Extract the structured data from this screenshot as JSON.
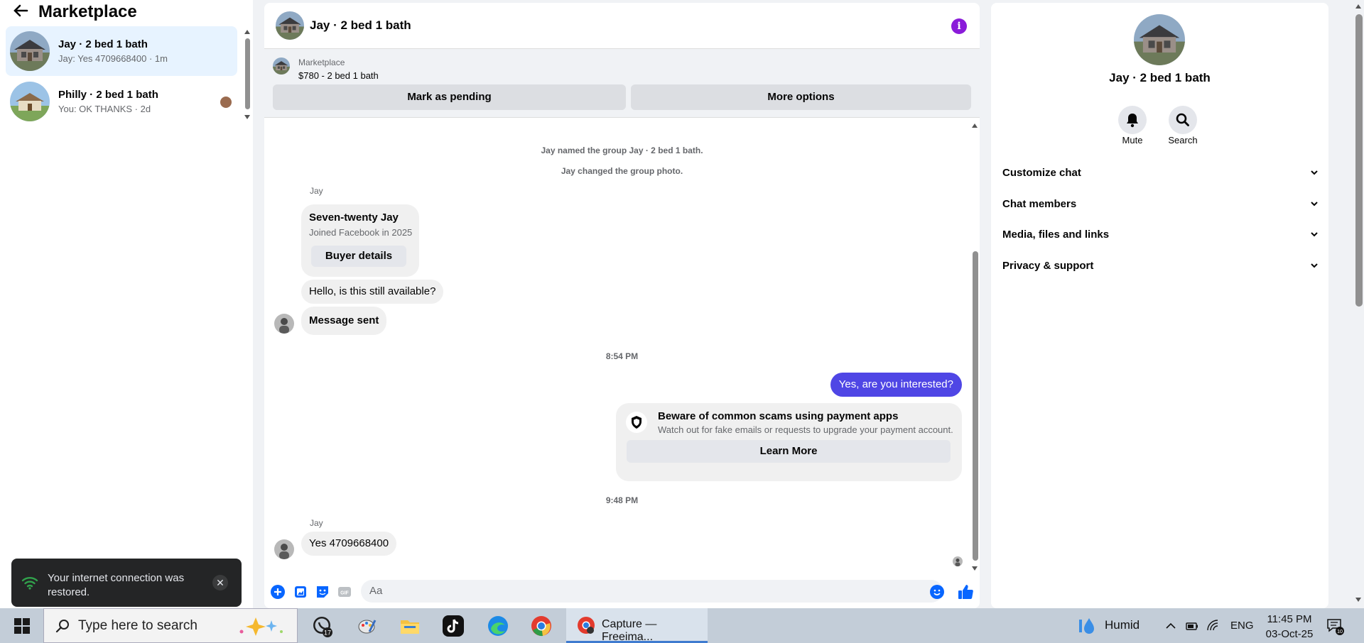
{
  "sidebar": {
    "title": "Marketplace",
    "conversations": [
      {
        "name": "Jay · 2 bed 1 bath",
        "preview": "Jay: Yes 4709668400 · 1m"
      },
      {
        "name": "Philly · 2 bed 1 bath",
        "preview": "You: OK THANKS · 2d"
      }
    ]
  },
  "chat": {
    "title": "Jay · 2 bed 1 bath",
    "listing": {
      "source": "Marketplace",
      "price_title": "$780 - 2 bed 1 bath"
    },
    "buttons": {
      "mark_pending": "Mark as pending",
      "more_options": "More options"
    },
    "system_messages": [
      "Jay named the group Jay · 2 bed 1 bath.",
      "Jay changed the group photo."
    ],
    "sender_name": "Jay",
    "profile_card": {
      "name": "Seven-twenty Jay",
      "joined": "Joined Facebook in 2025",
      "button": "Buyer details"
    },
    "messages": {
      "m1": "Hello, is this still available?",
      "m2": "Message sent",
      "time1": "8:54 PM",
      "out1": "Yes, are you interested?",
      "time2": "9:48 PM",
      "m3": "Yes 4709668400"
    },
    "warning": {
      "title": "Beware of common scams using payment apps",
      "desc": "Watch out for fake emails or requests to upgrade your payment account.",
      "button": "Learn More"
    },
    "composer_placeholder": "Aa"
  },
  "details": {
    "name": "Jay · 2 bed 1 bath",
    "actions": {
      "mute": "Mute",
      "search": "Search"
    },
    "sections": [
      "Customize chat",
      "Chat members",
      "Media, files and links",
      "Privacy & support"
    ]
  },
  "toast": {
    "text": "Your internet connection was restored."
  },
  "taskbar": {
    "search_placeholder": "Type here to search",
    "whatsapp_badge": "17",
    "active_app": "Capture — Freeima...",
    "weather": "Humid",
    "language": "ENG",
    "time": "11:45 PM",
    "date": "03-Oct-25",
    "notification_count": "10"
  },
  "colors": {
    "accent": "#0866ff",
    "outgoing_bubble": "#4f46e5",
    "info": "#8a1bd9"
  }
}
